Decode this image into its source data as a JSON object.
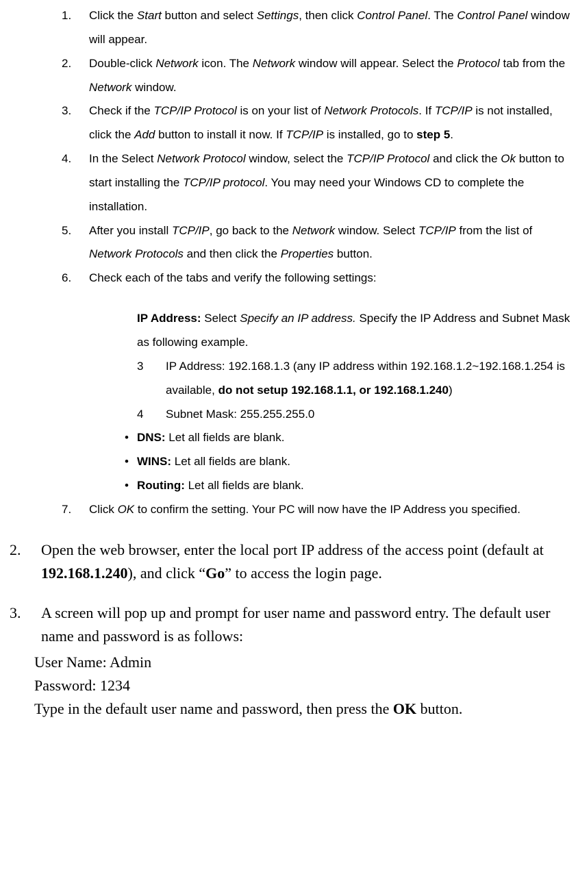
{
  "inner": {
    "items": [
      {
        "n": "1.",
        "parts": [
          "Click the ",
          "Start",
          " button and select ",
          "Settings",
          ", then click ",
          "Control Panel",
          ". The ",
          "Control Panel",
          " window will appear."
        ]
      },
      {
        "n": "2.",
        "parts": [
          "Double-click ",
          "Network",
          " icon. The ",
          "Network",
          " window will appear. Select the ",
          "Protocol",
          " tab from the ",
          "Network",
          " window."
        ]
      },
      {
        "n": "3.",
        "parts": [
          "Check if the ",
          "TCP/IP Protocol",
          " is on your list of ",
          "Network Protocols",
          ". If ",
          "TCP/IP",
          " is not installed, click the ",
          "Add",
          " button to install it now. If ",
          "TCP/IP",
          " is installed, go to ",
          "step 5",
          "."
        ]
      },
      {
        "n": "4.",
        "parts": [
          "In the Select ",
          "Network Protocol",
          " window, select the ",
          "TCP/IP Protocol",
          " and click the ",
          "Ok",
          "      button to start installing the ",
          "TCP/IP protocol",
          ". You may need your Windows CD to        complete the installation."
        ]
      },
      {
        "n": "5.",
        "parts": [
          "After you install ",
          "TCP/IP",
          ", go back to the ",
          "Network",
          " window. Select ",
          "TCP/IP",
          " from the list of ",
          "Network Protocols",
          " and then click the ",
          "Properties",
          " button."
        ]
      },
      {
        "n": "6.",
        "text": "Check each of the tabs and verify the following settings:"
      },
      {
        "n": "7.",
        "parts": [
          "Click ",
          "OK",
          " to confirm the setting. Your PC will now have the IP Address you specified."
        ]
      }
    ]
  },
  "ip_block": {
    "lead_bold": "IP Address:",
    "lead_rest1": " Select ",
    "lead_italic": "Specify an IP address.",
    "lead_rest2": " Specify the IP Address and Subnet Mask as following example.",
    "sub3_n": "3",
    "sub3_a": "IP Address: 192.168.1.3 (any IP address within 192.168.1.2~192.168.1.254 is available, ",
    "sub3_bold": "do not setup 192.168.1.1, or 192.168.1.240",
    "sub3_end": ")",
    "sub4_n": "4",
    "sub4_text": "Subnet Mask: 255.255.255.0"
  },
  "bullets": [
    {
      "bold": "DNS:",
      "rest": " Let all fields are blank."
    },
    {
      "bold": "WINS:",
      "rest": " Let all fields are blank."
    },
    {
      "bold": "Routing:",
      "rest": " Let all fields are blank."
    }
  ],
  "outer2": {
    "n": "2.",
    "a": "Open the web browser, enter the local port IP address of the access point (default at ",
    "bold1": "192.168.1.240",
    "b": "), and click “",
    "bold2": "Go",
    "c": "” to access the login page."
  },
  "outer3": {
    "n": "3.",
    "line": "A screen will pop up and prompt for user name and password entry. The default user name and password is as follows:",
    "user_label": "User Name: Admin",
    "pass_label": "Password: 1234",
    "final_a": "Type in the default user name and password, then press the ",
    "final_bold": "OK",
    "final_b": " button."
  }
}
